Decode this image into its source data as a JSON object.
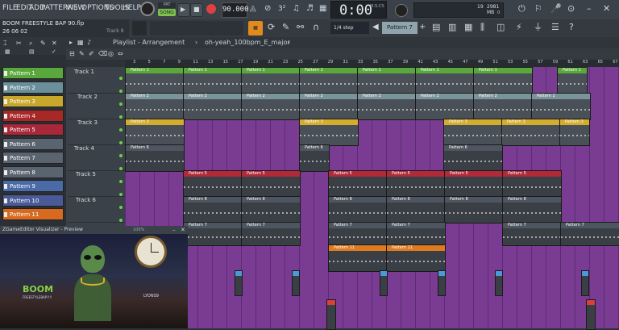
{
  "menu": [
    "FILE",
    "EDIT",
    "ADD",
    "PATTERNS",
    "VIEW",
    "OPTIONS",
    "TOOLS",
    "HELP"
  ],
  "transport": {
    "song_label": "SONG",
    "tempo": "90.000",
    "time": "0:00",
    "time_unit": "M:S:CS",
    "cpu_value": "19",
    "memory": "2981 MB",
    "memory_sub": "0"
  },
  "project": {
    "title": "BOOM FREESTYLE BAP 90.flp",
    "date": "26 06 02",
    "track_hint": "Track 9"
  },
  "toolbar": {
    "snap": "1/4 step",
    "pattern": "Pattern 7"
  },
  "playlist": {
    "title": "Playlist - Arrangement",
    "arrangement": "oh-yeah_100bpm_E_major"
  },
  "ruler": [
    "3",
    "5",
    "7",
    "9",
    "11",
    "13",
    "15",
    "17",
    "19",
    "21",
    "23",
    "25",
    "27",
    "29",
    "31",
    "33",
    "35",
    "37",
    "39",
    "41",
    "43",
    "45",
    "47",
    "49",
    "51",
    "53",
    "55",
    "57",
    "59",
    "61",
    "63",
    "65",
    "67"
  ],
  "channels": [
    {
      "name": "Pattern 1",
      "color": "#5aa83c"
    },
    {
      "name": "Pattern 2",
      "color": "#6b8f9a"
    },
    {
      "name": "Pattern 3",
      "color": "#c8a82b"
    },
    {
      "name": "Pattern 4",
      "color": "#a82828"
    },
    {
      "name": "Pattern 5",
      "color": "#a8283a"
    },
    {
      "name": "Pattern 6",
      "color": "#5a6470"
    },
    {
      "name": "Pattern 7",
      "color": "#5a6470"
    },
    {
      "name": "Pattern 8",
      "color": "#5a6470"
    },
    {
      "name": "Pattern 9",
      "color": "#4a6aa8"
    },
    {
      "name": "Pattern 10",
      "color": "#4a5a98"
    },
    {
      "name": "Pattern 11",
      "color": "#d86a20"
    }
  ],
  "tracks": [
    "Track 1",
    "Track 2",
    "Track 3",
    "Track 4",
    "Track 5",
    "Track 6"
  ],
  "preview": {
    "title": "ZGameEditor Visualizer - Preview",
    "zoom": "100%",
    "boom": "BOOM",
    "freestyle": "FREESTYLEBAP!!!!",
    "tag": "LYONS9"
  },
  "colors": {
    "grid": "#7a3c92",
    "p1": "#5aa83c",
    "p2": "#7a949c",
    "p3": "#d4ad2e",
    "p5": "#b02a3a",
    "dark": "#4d5560",
    "orange": "#e07a20"
  }
}
